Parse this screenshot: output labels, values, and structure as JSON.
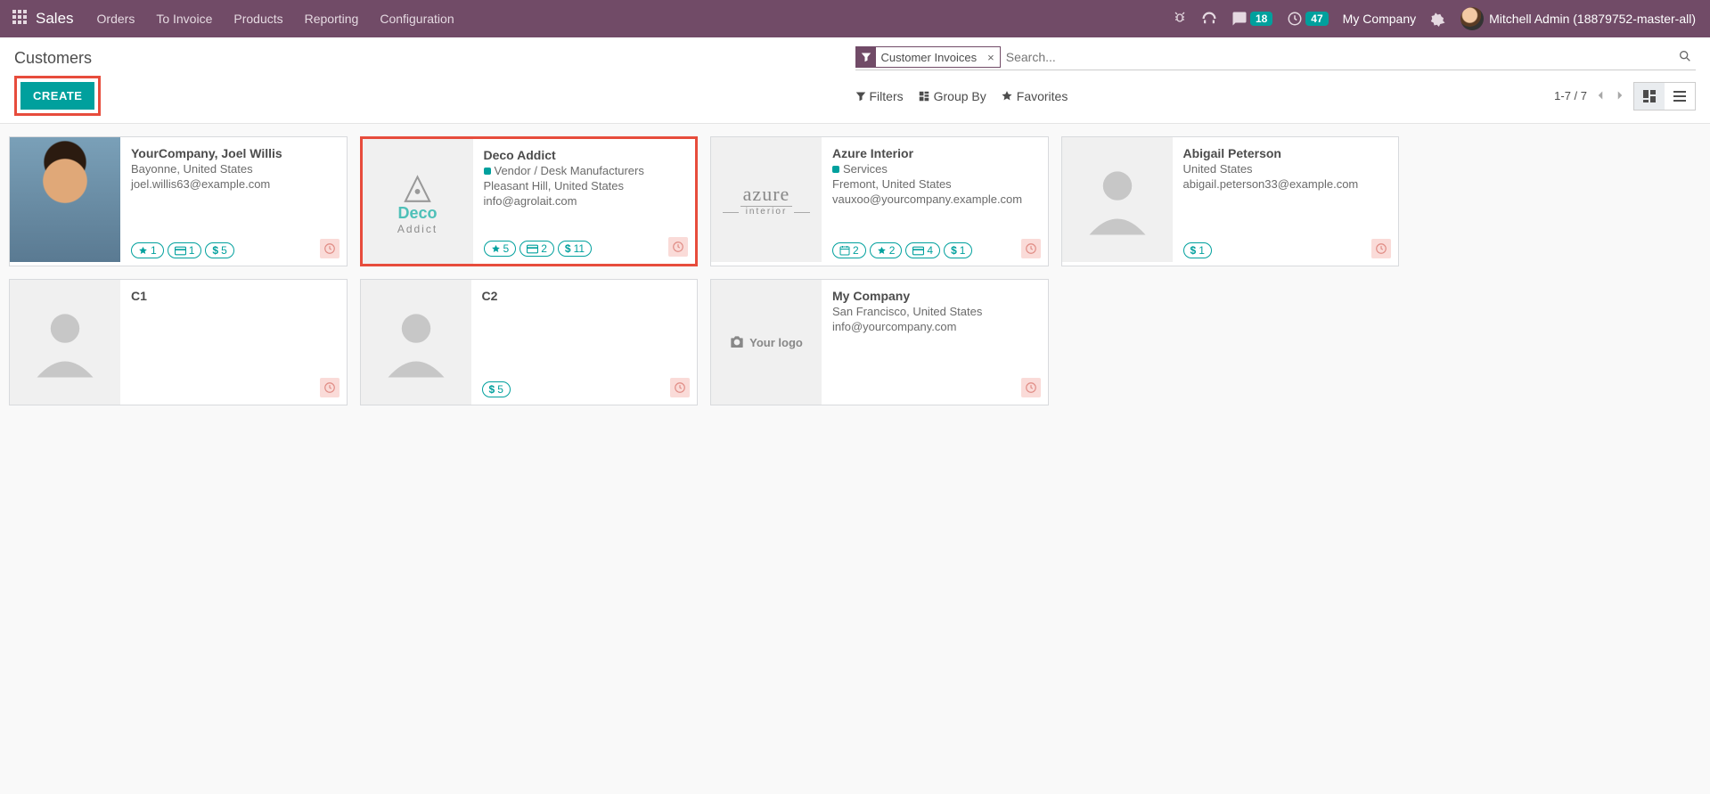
{
  "topnav": {
    "brand": "Sales",
    "menu": [
      "Orders",
      "To Invoice",
      "Products",
      "Reporting",
      "Configuration"
    ],
    "messages_badge": "18",
    "activities_badge": "47",
    "company": "My Company",
    "user": "Mitchell Admin (18879752-master-all)"
  },
  "breadcrumb": "Customers",
  "search": {
    "facet_label": "Customer Invoices",
    "placeholder": "Search..."
  },
  "buttons": {
    "create": "CREATE",
    "filters": "Filters",
    "groupby": "Group By",
    "favorites": "Favorites"
  },
  "pager": "1-7 / 7",
  "customers": [
    {
      "name": "YourCompany, Joel Willis",
      "location": "Bayonne, United States",
      "email": "joel.willis63@example.com",
      "tag": null,
      "pills": [
        {
          "icon": "star",
          "value": "1"
        },
        {
          "icon": "card",
          "value": "1"
        },
        {
          "icon": "dollar",
          "value": "5"
        }
      ],
      "avatar_type": "photo",
      "activity_overdue": true,
      "highlighted": false
    },
    {
      "name": "Deco Addict",
      "location": "Pleasant Hill, United States",
      "email": "info@agrolait.com",
      "tag": "Vendor / Desk Manufacturers",
      "pills": [
        {
          "icon": "star",
          "value": "5"
        },
        {
          "icon": "card",
          "value": "2"
        },
        {
          "icon": "dollar",
          "value": "11"
        }
      ],
      "avatar_type": "deco",
      "activity_overdue": true,
      "highlighted": true
    },
    {
      "name": "Azure Interior",
      "location": "Fremont, United States",
      "email": "vauxoo@yourcompany.example.com",
      "tag": "Services",
      "pills": [
        {
          "icon": "calendar",
          "value": "2"
        },
        {
          "icon": "star",
          "value": "2"
        },
        {
          "icon": "card",
          "value": "4"
        },
        {
          "icon": "dollar",
          "value": "1"
        }
      ],
      "avatar_type": "azure",
      "activity_overdue": true,
      "highlighted": false
    },
    {
      "name": "Abigail Peterson",
      "location": "United States",
      "email": "abigail.peterson33@example.com",
      "tag": null,
      "pills": [
        {
          "icon": "dollar",
          "value": "1"
        }
      ],
      "avatar_type": "placeholder",
      "activity_overdue": true,
      "highlighted": false
    },
    {
      "name": "C1",
      "location": null,
      "email": null,
      "tag": null,
      "pills": [],
      "avatar_type": "placeholder",
      "activity_overdue": true,
      "highlighted": false
    },
    {
      "name": "C2",
      "location": null,
      "email": null,
      "tag": null,
      "pills": [
        {
          "icon": "dollar",
          "value": "5"
        }
      ],
      "avatar_type": "placeholder",
      "activity_overdue": true,
      "highlighted": false
    },
    {
      "name": "My Company",
      "location": "San Francisco, United States",
      "email": "info@yourcompany.com",
      "tag": null,
      "pills": [],
      "avatar_type": "yourlogo",
      "yourlogo_text": "Your logo",
      "activity_overdue": true,
      "highlighted": false
    }
  ]
}
